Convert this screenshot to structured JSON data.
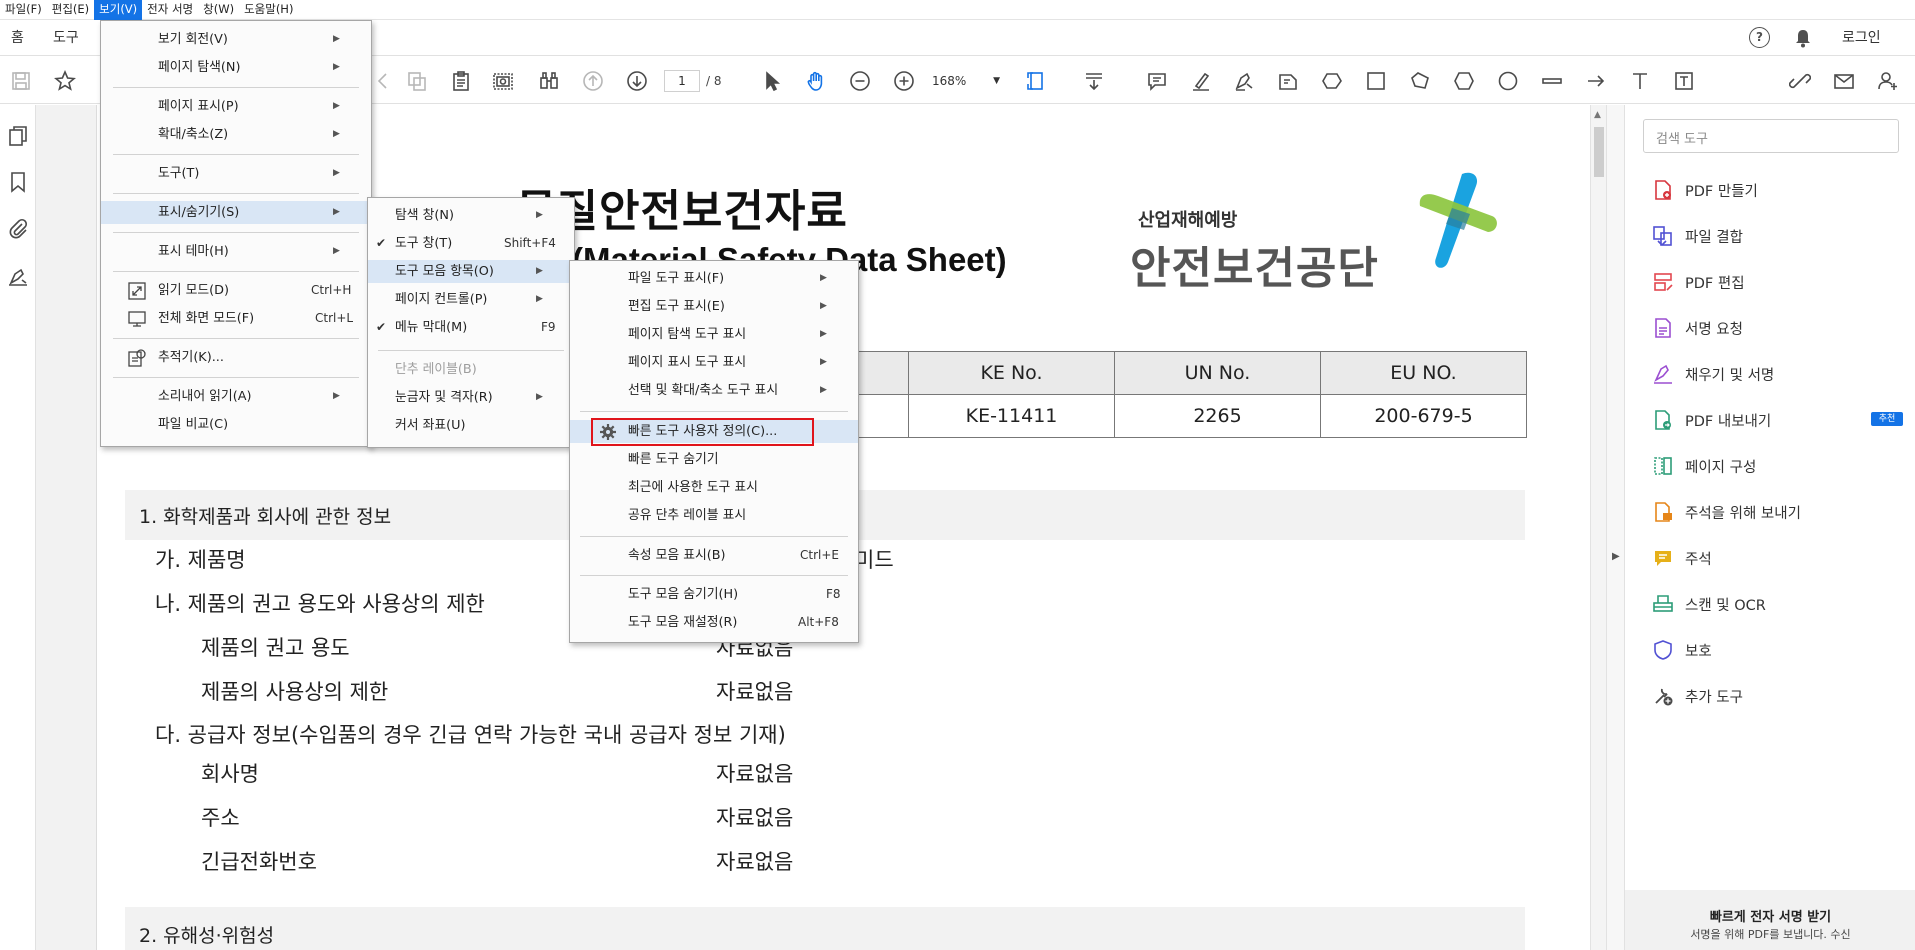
{
  "menubar": [
    "파일(F)",
    "편집(E)",
    "보기(V)",
    "전자 서명",
    "창(W)",
    "도움말(H)"
  ],
  "appbar": {
    "home": "홈",
    "tools": "도구",
    "login": "로그인"
  },
  "toolbar": {
    "page_current": "1",
    "page_total": "/ 8",
    "zoom": "168%"
  },
  "view_menu": [
    {
      "label": "보기 회전(V)",
      "sub": true
    },
    {
      "label": "페이지 탐색(N)",
      "sub": true
    },
    {
      "label": "페이지 표시(P)",
      "sub": true
    },
    {
      "label": "확대/축소(Z)",
      "sub": true
    },
    {
      "label": "도구(T)",
      "sub": true
    },
    {
      "label": "표시/숨기기(S)",
      "sub": true,
      "highlight": true
    },
    {
      "label": "표시 테마(H)",
      "sub": true
    },
    {
      "label": "읽기 모드(D)",
      "shortcut": "Ctrl+H",
      "icon": "reading-mode-icon"
    },
    {
      "label": "전체 화면 모드(F)",
      "shortcut": "Ctrl+L",
      "icon": "full-screen-icon"
    },
    {
      "label": "추적기(K)...",
      "icon": "tracker-icon"
    },
    {
      "label": "소리내어 읽기(A)",
      "sub": true
    },
    {
      "label": "파일 비교(C)"
    }
  ],
  "showhide_menu": [
    {
      "label": "탐색 창(N)",
      "sub": true
    },
    {
      "label": "도구 창(T)",
      "shortcut": "Shift+F4",
      "checked": true
    },
    {
      "label": "도구 모음 항목(O)",
      "sub": true,
      "highlight": true
    },
    {
      "label": "페이지 컨트롤(P)",
      "sub": true
    },
    {
      "label": "메뉴 막대(M)",
      "shortcut": "F9",
      "checked": true
    },
    {
      "label": "단추 레이블(B)",
      "disabled": true
    },
    {
      "label": "눈금자 및 격자(R)",
      "sub": true
    },
    {
      "label": "커서 좌표(U)"
    }
  ],
  "toolbar_items_menu": [
    {
      "label": "파일 도구 표시(F)",
      "sub": true
    },
    {
      "label": "편집 도구 표시(E)",
      "sub": true
    },
    {
      "label": "페이지 탐색 도구 표시",
      "sub": true
    },
    {
      "label": "페이지 표시 도구 표시",
      "sub": true
    },
    {
      "label": "선택 및 확대/축소 도구 표시",
      "sub": true
    },
    {
      "label": "빠른 도구 사용자 정의(C)...",
      "highlight": true,
      "icon": "gear-icon"
    },
    {
      "label": "빠른 도구 숨기기"
    },
    {
      "label": "최근에 사용한 도구 표시"
    },
    {
      "label": "공유 단추 레이블 표시"
    },
    {
      "label": "속성 모음 표시(B)",
      "shortcut": "Ctrl+E"
    },
    {
      "label": "도구 모음 숨기기(H)",
      "shortcut": "F8"
    },
    {
      "label": "도구 모음 재설정(R)",
      "shortcut": "Alt+F8"
    }
  ],
  "document": {
    "title": "물질안전보건자료",
    "subtitle": "(Material Safety Data Sheet)",
    "org_small": "산업재해예방",
    "org_big": "안전보건공단",
    "id_headers": [
      "KE No.",
      "UN No.",
      "EU NO."
    ],
    "id_values": [
      "KE-11411",
      "2265",
      "200-679-5"
    ],
    "section1": "1. 화학제품과 회사에 관한 정보",
    "product_name_label": "가. 제품명",
    "product_name_value": "미드",
    "use_label": "나. 제품의 권고 용도와 사용상의 제한",
    "rec_use_label": "제품의 권고 용도",
    "rec_use_value": "자료없음",
    "restriction_label": "제품의 사용상의 제한",
    "restriction_value": "자료없음",
    "supplier_label": "다. 공급자 정보(수입품의 경우 긴급 연락 가능한 국내 공급자 정보 기재)",
    "company_label": "회사명",
    "company_value": "자료없음",
    "address_label": "주소",
    "address_value": "자료없음",
    "phone_label": "긴급전화번호",
    "phone_value": "자료없음",
    "section2": "2. 유해성·위험성"
  },
  "right_panel": {
    "search_placeholder": "검색 도구",
    "tools": [
      "PDF 만들기",
      "파일 결합",
      "PDF 편집",
      "서명 요청",
      "채우기 및 서명",
      "PDF 내보내기",
      "페이지 구성",
      "주석을 위해 보내기",
      "주석",
      "스캔 및 OCR",
      "보호",
      "추가 도구"
    ],
    "badge": "추천",
    "promo_title": "빠르게 전자 서명 받기",
    "promo_text": "서명을 위해 PDF를 보냅니다. 수신"
  }
}
